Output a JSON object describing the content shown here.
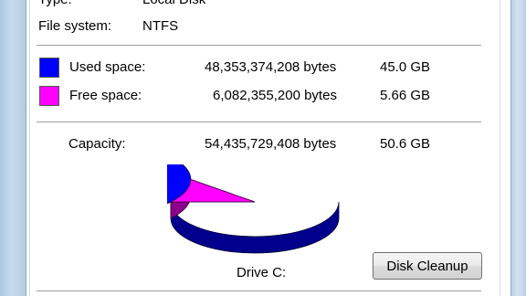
{
  "properties": {
    "type_label": "Type:",
    "type_value": "Local Disk",
    "filesystem_label": "File system:",
    "filesystem_value": "NTFS"
  },
  "used": {
    "label": "Used space:",
    "bytes": "48,353,374,208 bytes",
    "size": "45.0 GB",
    "color": "#0000ff"
  },
  "free": {
    "label": "Free space:",
    "bytes": "6,082,355,200 bytes",
    "size": "5.66 GB",
    "color": "#ff00ff"
  },
  "capacity": {
    "label": "Capacity:",
    "bytes": "54,435,729,408 bytes",
    "size": "50.6 GB"
  },
  "drive": {
    "label": "Drive C:",
    "used_fraction": 0.888
  },
  "buttons": {
    "disk_cleanup": "Disk Cleanup"
  }
}
